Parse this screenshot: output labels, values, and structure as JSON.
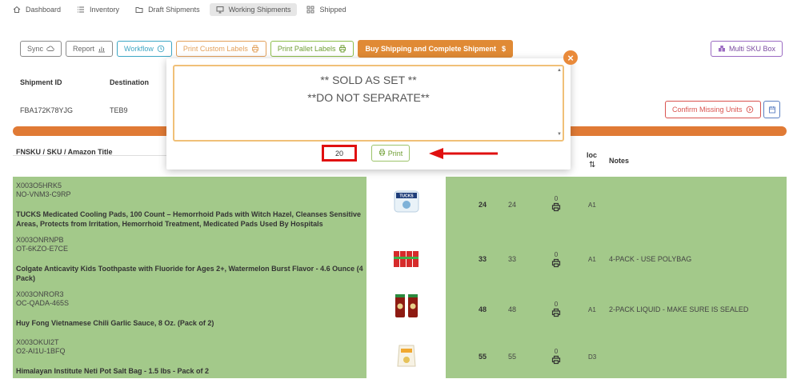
{
  "nav": {
    "items": [
      {
        "label": "Dashboard",
        "icon": "home-icon"
      },
      {
        "label": "Inventory",
        "icon": "list-icon"
      },
      {
        "label": "Draft Shipments",
        "icon": "folder-icon"
      },
      {
        "label": "Working Shipments",
        "icon": "monitor-icon",
        "active": true
      },
      {
        "label": "Shipped",
        "icon": "grid-icon"
      }
    ]
  },
  "toolbar": {
    "sync": "Sync",
    "report": "Report",
    "workflow": "Workflow",
    "print_custom": "Print Custom Labels",
    "print_pallet": "Print Pallet Labels",
    "buy_shipping": "Buy Shipping and Complete Shipment",
    "buy_icon": "$",
    "multi_sku": "Multi SKU Box"
  },
  "shipment": {
    "id_label": "Shipment ID",
    "dest_label": "Destination",
    "id_value": "FBA172K78YJG",
    "dest_value": "TEB9",
    "confirm_missing": "Confirm Missing Units"
  },
  "table": {
    "col_item": "FNSKU / SKU / Amazon Title",
    "col_loc": "loc",
    "col_notes": "Notes",
    "rows": [
      {
        "fnsku": "X003O5HRK5",
        "sku": "NO-VNM3-C9RP",
        "title": "TUCKS Medicated Cooling Pads, 100 Count – Hemorrhoid Pads with Witch Hazel, Cleanses Sensitive Areas, Protects from Irritation, Hemorrhoid Treatment, Medicated Pads Used By Hospitals",
        "qty": "24",
        "qty2": "24",
        "print_count": "0",
        "loc": "A1",
        "note": ""
      },
      {
        "fnsku": "X003ONRNPB",
        "sku": "OT-6KZO-E7CE",
        "title": "Colgate Anticavity Kids Toothpaste with Fluoride for Ages 2+, Watermelon Burst Flavor - 4.6 Ounce (4 Pack)",
        "qty": "33",
        "qty2": "33",
        "print_count": "0",
        "loc": "A1",
        "note": "4-PACK - USE POLYBAG"
      },
      {
        "fnsku": "X003ONROR3",
        "sku": "OC-QADA-465S",
        "title": "Huy Fong Vietnamese Chili Garlic Sauce, 8 Oz. (Pack of 2)",
        "qty": "48",
        "qty2": "48",
        "print_count": "0",
        "loc": "A1",
        "note": "2-PACK LIQUID - MAKE SURE IS SEALED"
      },
      {
        "fnsku": "X003OKUI2T",
        "sku": "O2-AI1U-1BFQ",
        "title": "Himalayan Institute Neti Pot Salt Bag - 1.5 lbs - Pack of 2",
        "qty": "55",
        "qty2": "55",
        "print_count": "0",
        "loc": "D3",
        "note": ""
      }
    ]
  },
  "modal": {
    "text": "** SOLD AS SET **\n**DO NOT SEPARATE**",
    "quantity": "20",
    "print": "Print",
    "close": "×"
  },
  "colors": {
    "row_green": "#a3c98a",
    "accent_orange": "#e08a35",
    "highlight_red": "#e01010"
  }
}
